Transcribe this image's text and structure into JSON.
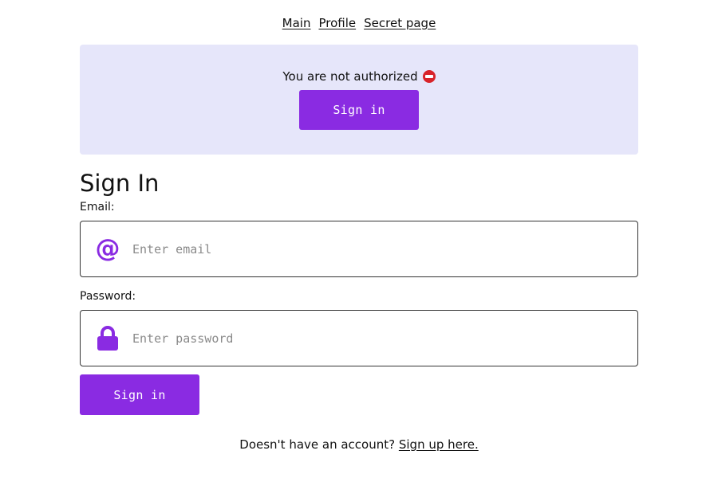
{
  "nav": {
    "items": [
      {
        "label": "Main"
      },
      {
        "label": "Profile"
      },
      {
        "label": "Secret page"
      }
    ]
  },
  "banner": {
    "message": "You are not authorized",
    "icon": "no-entry-icon",
    "button_label": "Sign in",
    "background": "#e6e6fa"
  },
  "form": {
    "title": "Sign In",
    "email": {
      "label": "Email:",
      "placeholder": "Enter email",
      "value": "",
      "icon": "at-sign-icon"
    },
    "password": {
      "label": "Password:",
      "placeholder": "Enter password",
      "value": "",
      "icon": "lock-icon"
    },
    "submit_label": "Sign in"
  },
  "footer": {
    "text": "Doesn't have an account?",
    "link_label": "Sign up here."
  },
  "colors": {
    "accent": "#8a2be2",
    "error": "#d8232a"
  }
}
